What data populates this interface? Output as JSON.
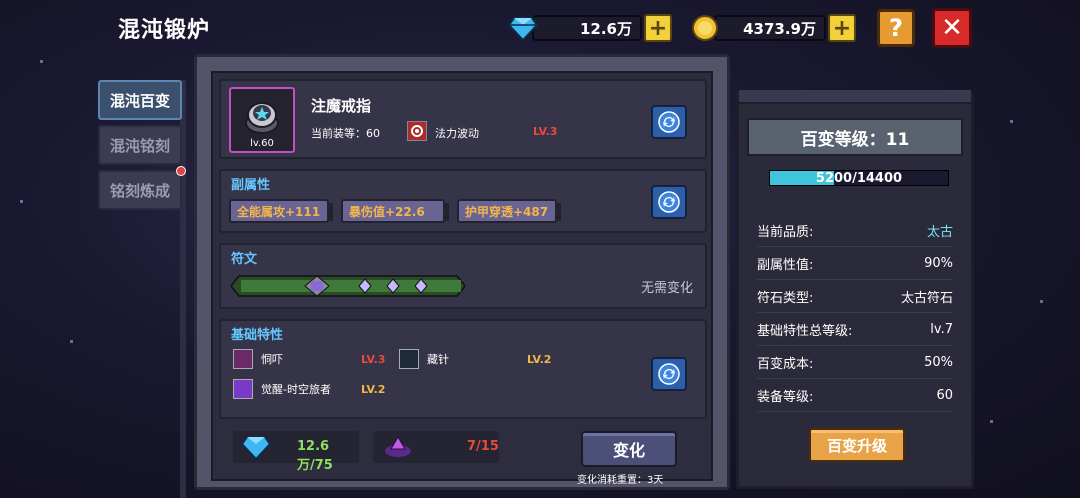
{
  "title": "混沌锻炉",
  "resources": {
    "gems": "12.6万",
    "gold": "4373.9万",
    "plus_label": "+"
  },
  "top_buttons": {
    "help": "?",
    "close": "✕"
  },
  "tabs": [
    {
      "label": "混沌百变",
      "active": true
    },
    {
      "label": "混沌铭刻",
      "active": false
    },
    {
      "label": "铭刻炼成",
      "active": false
    }
  ],
  "item": {
    "name": "注魔戒指",
    "level": "lv.60",
    "equip_level": "当前装等：60",
    "skill_name": "法力波动",
    "skill_level": "LV.3"
  },
  "sub_attributes": {
    "label": "副属性",
    "chips": [
      "全能属攻+111",
      "暴伤值+22.6",
      "护甲穿透+487"
    ]
  },
  "rune": {
    "label": "符文",
    "status": "无需变化"
  },
  "base_traits": {
    "label": "基础特性",
    "traits": [
      {
        "name": "恫吓",
        "level": "LV.3",
        "level_color": "#e84a3a"
      },
      {
        "name": "藏针",
        "level": "LV.2",
        "level_color": "#f2b64a"
      },
      {
        "name": "觉醒-时空旅者",
        "level": "LV.2",
        "level_color": "#f2b64a"
      }
    ]
  },
  "costs": {
    "gems": "12.6万/75",
    "fragments": "7/15"
  },
  "change_button": "变化",
  "reset_note": "变化消耗重置：3天",
  "right_panel": {
    "header": "百变等级：11",
    "xp_text": "5200/14400",
    "xp_fraction": 0.361,
    "stats": [
      {
        "label": "当前品质:",
        "value": "太古",
        "highlight": true
      },
      {
        "label": "副属性值:",
        "value": "90%",
        "highlight": false
      },
      {
        "label": "符石类型:",
        "value": "太古符石",
        "highlight": false
      },
      {
        "label": "基础特性总等级:",
        "value": "lv.7",
        "highlight": false
      },
      {
        "label": "百变成本:",
        "value": "50%",
        "highlight": false
      },
      {
        "label": "装备等级:",
        "value": "60",
        "highlight": false
      }
    ],
    "upgrade_button": "百变升级"
  }
}
